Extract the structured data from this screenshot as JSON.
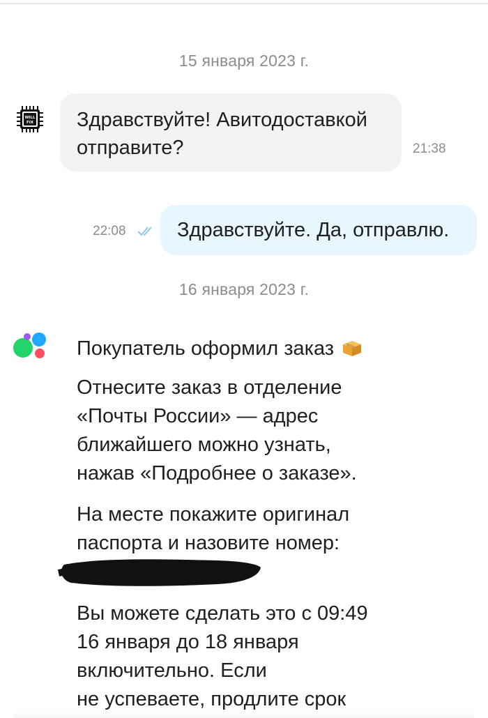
{
  "chat": {
    "date_1": "15 января 2023 г.",
    "incoming_message": {
      "text_line_1": "Здравствуйте! Авитодоставкой",
      "text_line_2": "отправите?",
      "time": "21:38"
    },
    "outgoing_message": {
      "text": "Здравствуйте. Да, отправлю.",
      "time": "22:08",
      "status_icon": "double-check-icon"
    },
    "date_2": "16 января 2023 г.",
    "system_message": {
      "title": "Покупатель оформил заказ",
      "title_icon": "package-icon",
      "para_1": [
        "Отнесите заказ в отделение",
        "«Почты России» — адрес",
        "ближайшего можно узнать,",
        "нажав «Подробнее о заказе»."
      ],
      "para_2": [
        "На месте покажите оригинал",
        "паспорта и назовите номер:"
      ],
      "para_3": [
        "Вы можете сделать это с 09:49",
        "16 января до 18 января",
        "включительно. Если",
        "не успеваете, продлите срок"
      ]
    }
  },
  "colors": {
    "incoming_bubble": "#f3f3f3",
    "outgoing_bubble": "#e8f6ff",
    "meta_text": "#8c8c8c",
    "read_check": "#8fc8ee"
  }
}
